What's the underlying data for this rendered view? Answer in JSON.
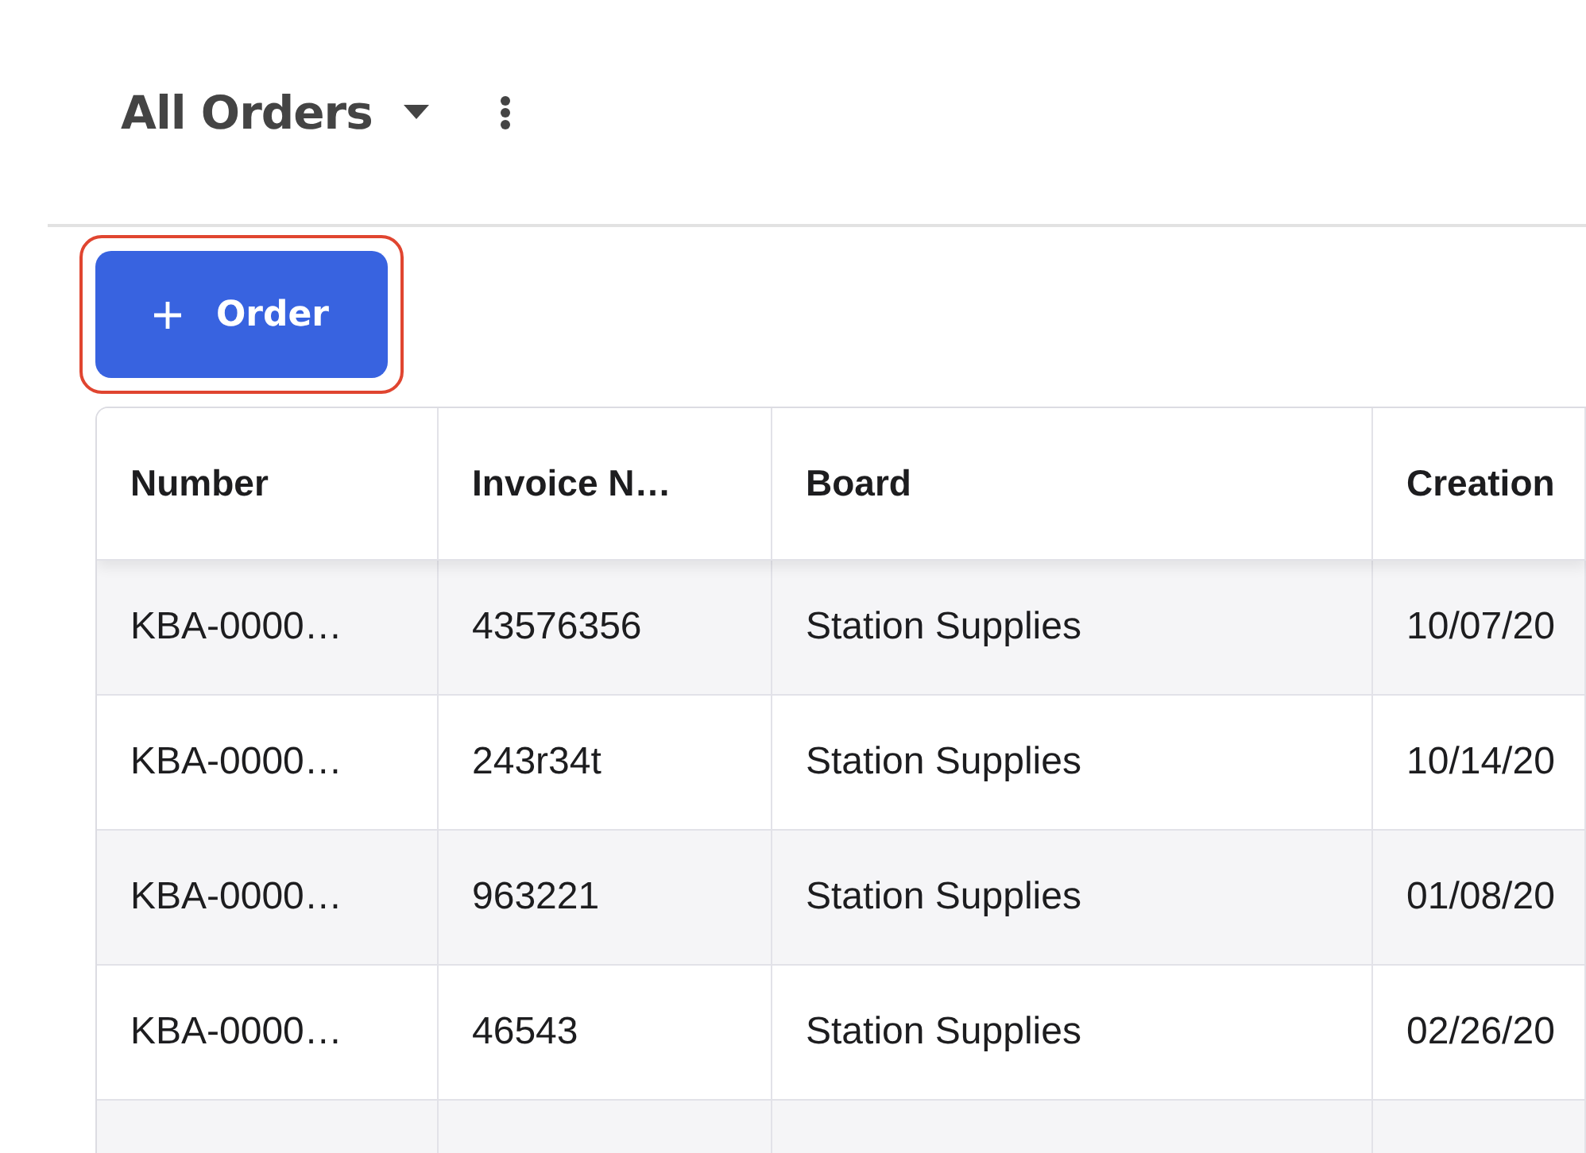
{
  "view": {
    "title": "All Orders"
  },
  "add_button": {
    "label": "Order",
    "highlighted": true
  },
  "table": {
    "columns": [
      "Number",
      "Invoice N…",
      "Board",
      "Creation"
    ],
    "rows": [
      {
        "cells": [
          "KBA-0000…",
          "43576356",
          "Station Supplies",
          "10/07/20"
        ]
      },
      {
        "cells": [
          "KBA-0000…",
          "243r34t",
          "Station Supplies",
          "10/14/20"
        ]
      },
      {
        "cells": [
          "KBA-0000…",
          "963221",
          "Station Supplies",
          "01/08/20"
        ]
      },
      {
        "cells": [
          "KBA-0000…",
          "46543",
          "Station Supplies",
          "02/26/20"
        ]
      }
    ]
  }
}
